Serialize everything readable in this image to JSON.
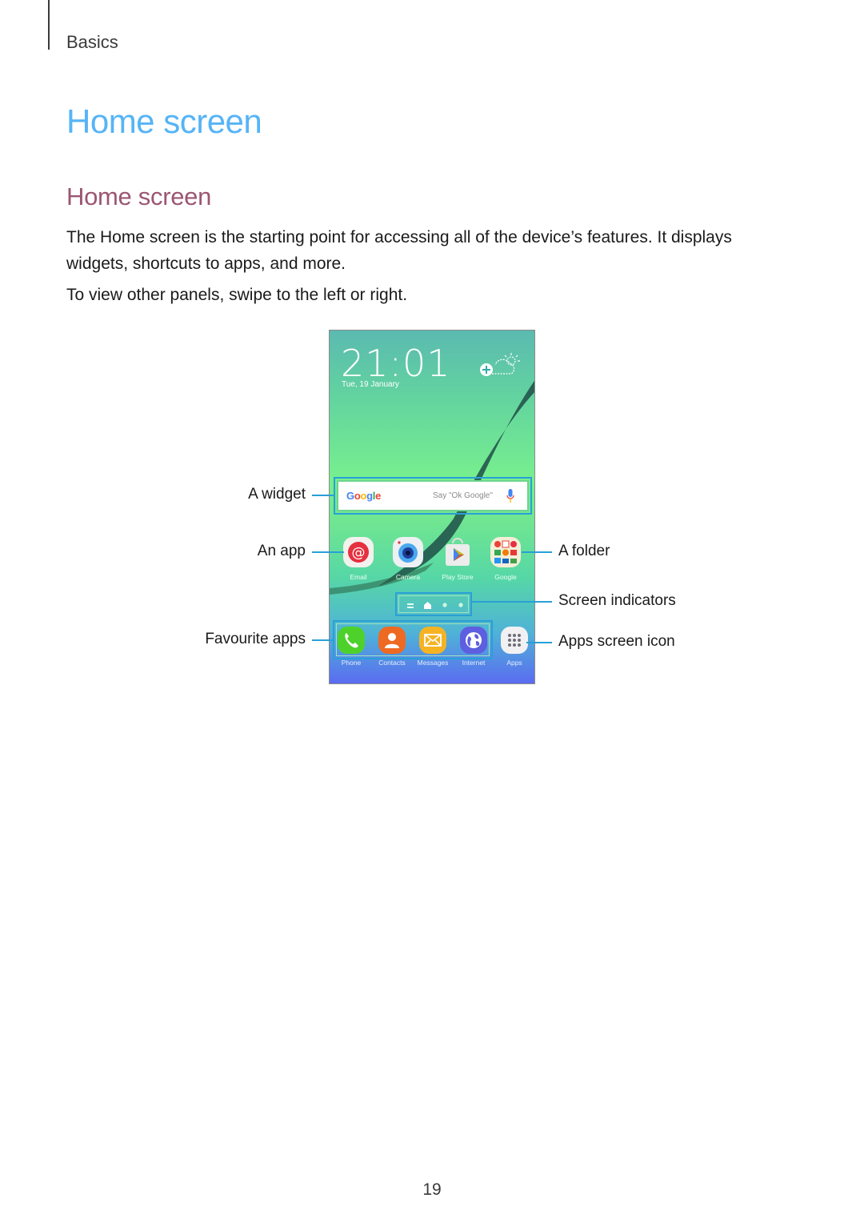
{
  "header": {
    "section": "Basics"
  },
  "page_title": "Home screen",
  "section": {
    "heading": "Home screen",
    "paragraphs": [
      "The Home screen is the starting point for accessing all of the device’s features. It displays widgets, shortcuts to apps, and more.",
      "To view other panels, swipe to the left or right."
    ]
  },
  "phone": {
    "clock": "21:01",
    "date": "Tue, 19 January",
    "widget": {
      "logo": "Google",
      "hint": "Say \"Ok Google\"",
      "icons": [
        "mic-icon"
      ]
    },
    "apps": [
      {
        "label": "Email",
        "icon": "email-icon",
        "color": "#e5303f"
      },
      {
        "label": "Camera",
        "icon": "camera-icon",
        "color": "#2f6fd8"
      },
      {
        "label": "Play Store",
        "icon": "play-store-icon",
        "color": "#34a853"
      },
      {
        "label": "Google",
        "icon": "folder-icon",
        "color": "#f4eed8"
      }
    ],
    "screen_indicators": [
      "menu-icon",
      "home-icon",
      "dot-icon",
      "dot-icon"
    ],
    "active_indicator": 1,
    "dock": [
      {
        "label": "Phone",
        "icon": "phone-icon",
        "color": "#4fd12b"
      },
      {
        "label": "Contacts",
        "icon": "contacts-icon",
        "color": "#ee6a22"
      },
      {
        "label": "Messages",
        "icon": "messages-icon",
        "color": "#f5b324"
      },
      {
        "label": "Internet",
        "icon": "internet-icon",
        "color": "#5e5ee0"
      },
      {
        "label": "Apps",
        "icon": "apps-grid-icon",
        "color": "#f1f1f4"
      }
    ]
  },
  "callouts": {
    "widget": "A widget",
    "app": "An app",
    "favourite_apps": "Favourite apps",
    "folder": "A folder",
    "screen_indicators": "Screen indicators",
    "apps_screen_icon": "Apps screen icon"
  },
  "colors": {
    "title_blue": "#56b4f6",
    "heading_mauve": "#9b5673",
    "callout_blue": "#2a9fd6"
  },
  "footer": {
    "page_number": "19"
  }
}
